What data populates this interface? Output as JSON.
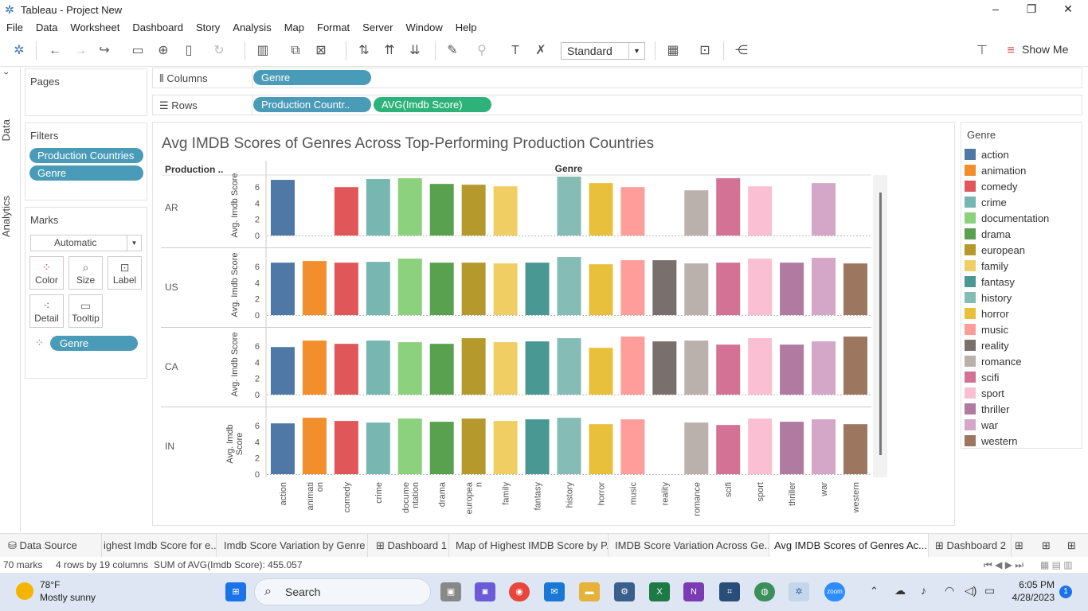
{
  "window": {
    "title": "Tableau - Project New",
    "minimize": "–",
    "maximize": "❐",
    "close": "✕"
  },
  "menu": [
    "File",
    "Data",
    "Worksheet",
    "Dashboard",
    "Story",
    "Analysis",
    "Map",
    "Format",
    "Server",
    "Window",
    "Help"
  ],
  "toolbar": {
    "fit_select": "Standard",
    "show_me": "Show Me"
  },
  "side_tabs": {
    "data": "Data",
    "analytics": "Analytics"
  },
  "pages": {
    "title": "Pages"
  },
  "filters": {
    "title": "Filters",
    "items": [
      "Production Countries",
      "Genre"
    ]
  },
  "marks": {
    "title": "Marks",
    "type": "Automatic",
    "buttons": [
      "Color",
      "Size",
      "Label",
      "Detail",
      "Tooltip"
    ],
    "pill": "Genre"
  },
  "shelves": {
    "columns_label": "Columns",
    "rows_label": "Rows",
    "columns_pill": "Genre",
    "rows_pills": [
      "Production Countr..",
      "AVG(Imdb Score)"
    ]
  },
  "legend": {
    "title": "Genre",
    "items": [
      {
        "label": "action",
        "color": "#4e79a7"
      },
      {
        "label": "animation",
        "color": "#f28e2b"
      },
      {
        "label": "comedy",
        "color": "#e15759"
      },
      {
        "label": "crime",
        "color": "#76b7b2"
      },
      {
        "label": "documentation",
        "color": "#8cd17d"
      },
      {
        "label": "drama",
        "color": "#59a14f"
      },
      {
        "label": "european",
        "color": "#b6992d"
      },
      {
        "label": "family",
        "color": "#f1ce63"
      },
      {
        "label": "fantasy",
        "color": "#499894"
      },
      {
        "label": "history",
        "color": "#86bcb6"
      },
      {
        "label": "horror",
        "color": "#e9c039"
      },
      {
        "label": "music",
        "color": "#ff9d9a"
      },
      {
        "label": "reality",
        "color": "#79706e"
      },
      {
        "label": "romance",
        "color": "#bab0ac"
      },
      {
        "label": "scifi",
        "color": "#d37295"
      },
      {
        "label": "sport",
        "color": "#fabfd2"
      },
      {
        "label": "thriller",
        "color": "#b07aa1"
      },
      {
        "label": "war",
        "color": "#d4a6c8"
      },
      {
        "label": "western",
        "color": "#9d7660"
      }
    ]
  },
  "chart_data": {
    "type": "bar",
    "title": "Avg IMDB Scores of Genres Across Top-Performing Production Countries",
    "row_header": "Production ..",
    "column_header": "Genre",
    "ylabel": "Avg. Imdb Score",
    "ylabel_short": [
      "Avg. Imdb",
      "Score"
    ],
    "ylim": [
      0,
      7.5
    ],
    "yticks": [
      0,
      2,
      4,
      6
    ],
    "categories": [
      "action",
      "animation",
      "comedy",
      "crime",
      "documentation",
      "drama",
      "european",
      "family",
      "fantasy",
      "history",
      "horror",
      "music",
      "reality",
      "romance",
      "scifi",
      "sport",
      "thriller",
      "war",
      "western"
    ],
    "category_labels": [
      "action",
      "animati on",
      "comedy",
      "crime",
      "docume ntation",
      "drama",
      "europea n",
      "family",
      "fantasy",
      "history",
      "horror",
      "music",
      "reality",
      "romance",
      "scifi",
      "sport",
      "thriller",
      "war",
      "western"
    ],
    "series": [
      {
        "name": "AR",
        "values": [
          6.9,
          null,
          6.0,
          7.0,
          7.1,
          6.4,
          6.3,
          6.1,
          null,
          7.3,
          6.5,
          6.0,
          null,
          5.6,
          7.1,
          6.1,
          null,
          6.5
        ]
      },
      {
        "name": "US",
        "values": [
          6.5,
          6.7,
          6.5,
          6.6,
          7.0,
          6.5,
          6.5,
          6.4,
          6.5,
          7.2,
          6.3,
          6.8,
          6.8,
          6.4,
          6.5,
          7.0,
          6.5,
          7.1,
          6.4
        ]
      },
      {
        "name": "CA",
        "values": [
          5.9,
          6.7,
          6.3,
          6.7,
          6.5,
          6.3,
          7.0,
          6.5,
          6.6,
          7.0,
          5.8,
          7.2,
          6.6,
          6.7,
          6.2,
          7.0,
          6.2,
          6.6,
          7.2
        ]
      },
      {
        "name": "IN",
        "values": [
          6.3,
          7.0,
          6.6,
          6.4,
          6.9,
          6.5,
          6.9,
          6.6,
          6.8,
          7.0,
          6.2,
          6.8,
          null,
          6.4,
          6.1,
          6.9,
          6.5,
          6.8,
          6.2
        ]
      }
    ]
  },
  "sheet_tabs": [
    "Data Source",
    "ighest Imdb Score for e...",
    "Imdb Score Variation by Genre",
    "Dashboard 1",
    "Map of Highest IMDB Score by P...",
    "IMDB Score Variation Across Ge...",
    "Avg IMDB Scores of Genres Ac...",
    "Dashboard 2"
  ],
  "status": {
    "marks": "70 marks",
    "rows_cols": "4 rows by 19 columns",
    "sum": "SUM of AVG(Imdb Score): 455.057"
  },
  "taskbar": {
    "temp": "78°F",
    "weather": "Mostly sunny",
    "search": "Search",
    "time": "6:05 PM",
    "date": "4/28/2023",
    "notif": "1"
  }
}
